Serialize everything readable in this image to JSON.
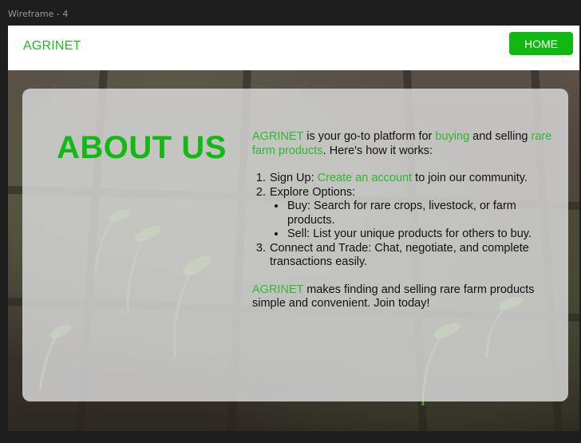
{
  "canvas": {
    "frame_label": "Wireframe - 4"
  },
  "navbar": {
    "brand": "AGRINET",
    "home_button": "HOME"
  },
  "about": {
    "title": "ABOUT US",
    "intro": {
      "brand": "AGRINET",
      "t1": " is your go-to platform for ",
      "buying": "buying",
      "t2": " and selling ",
      "rare": "rare farm products",
      "t3": ". Here's how it works:"
    },
    "steps": {
      "s1_prefix": "Sign Up: ",
      "s1_link": "Create an account",
      "s1_suffix": " to join our community.",
      "s2": "Explore Options:",
      "s2_buy": "Buy: Search for rare crops, livestock, or farm products.",
      "s2_sell": "Sell: List your unique products for others to buy.",
      "s3": "Connect and Trade: Chat, negotiate, and complete transactions easily."
    },
    "closing": {
      "brand": "AGRINET",
      "text": " makes finding and selling rare farm products simple and convenient. Join today!"
    }
  },
  "colors": {
    "accent": "#12b812",
    "highlight": "#2fb82f",
    "card": "#d5d5d5"
  }
}
